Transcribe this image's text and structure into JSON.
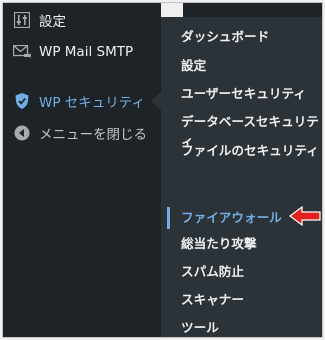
{
  "sidebar": {
    "items": [
      {
        "label": "設定",
        "icon": "settings-sliders-icon"
      },
      {
        "label": "WP Mail SMTP",
        "icon": "mail-icon"
      },
      {
        "label": "WP セキュリティ",
        "icon": "shield-icon"
      },
      {
        "label": "メニューを閉じる",
        "icon": "collapse-icon"
      }
    ]
  },
  "submenu": {
    "items": [
      {
        "label": "ダッシュボード"
      },
      {
        "label": "設定"
      },
      {
        "label": "ユーザーセキュリティ"
      },
      {
        "label": "データベースセキュリティ"
      },
      {
        "label": "ファイルのセキュリティ"
      },
      {
        "label": "ファイアウォール"
      },
      {
        "label": "総当たり攻撃"
      },
      {
        "label": "スパム防止"
      },
      {
        "label": "スキャナー"
      },
      {
        "label": "ツール"
      }
    ],
    "current": "ファイアウォール"
  },
  "colors": {
    "sidebar_bg": "#1d2327",
    "submenu_bg": "#2c3338",
    "accent": "#72aee6",
    "annotation_arrow": "#e0201c"
  }
}
